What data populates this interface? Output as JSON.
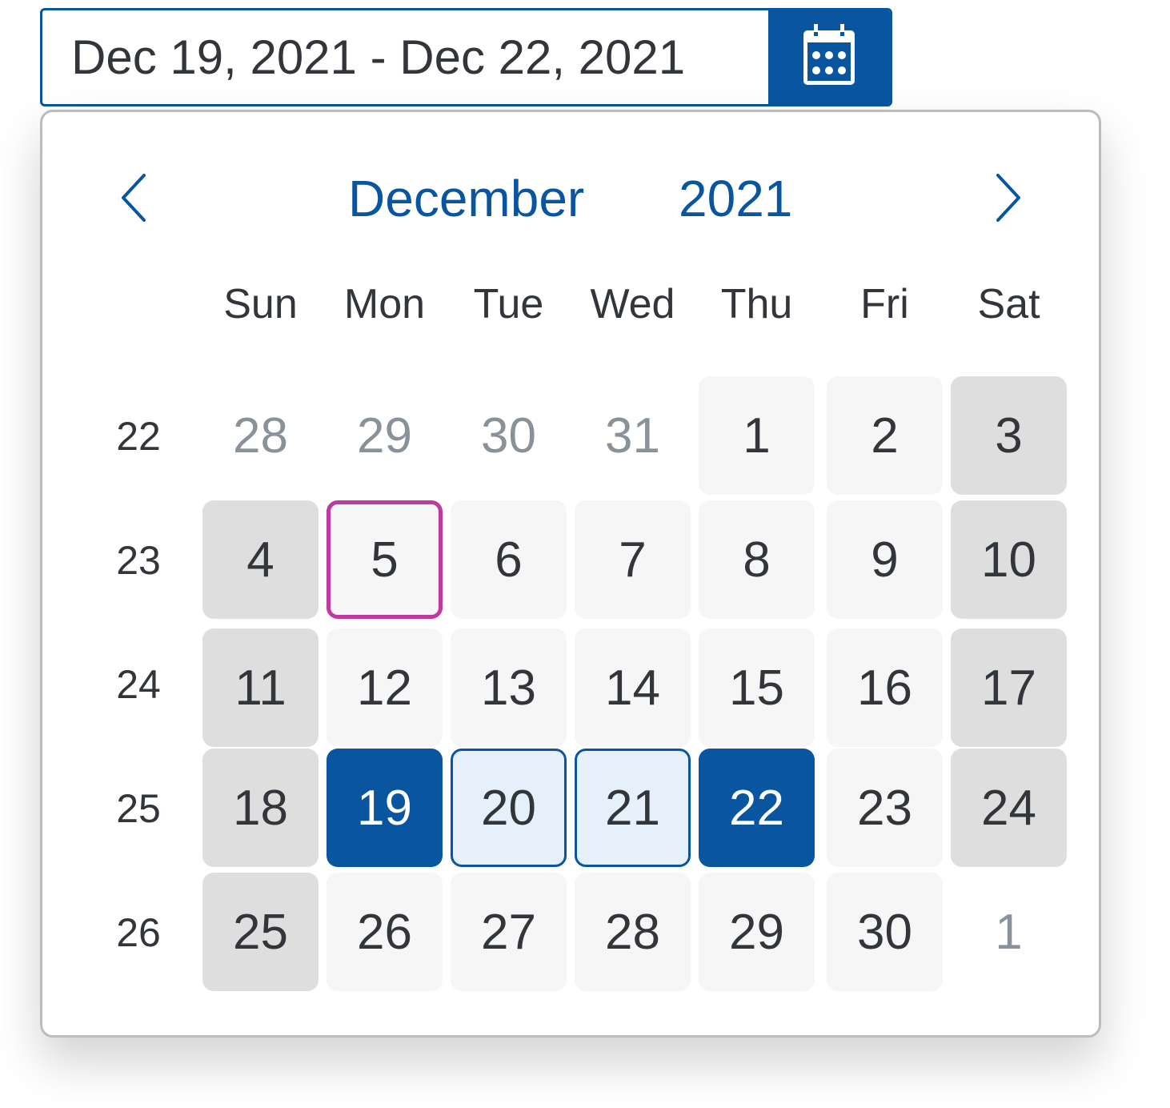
{
  "date_range_input": {
    "value": "Dec 19, 2021 - Dec 22, 2021",
    "button_icon": "calendar-icon"
  },
  "calendar": {
    "month_label": "December",
    "year_label": "2021",
    "prev_icon": "chevron-left-icon",
    "next_icon": "chevron-right-icon",
    "weekdays": [
      "Sun",
      "Mon",
      "Tue",
      "Wed",
      "Thu",
      "Fri",
      "Sat"
    ],
    "weeks": [
      {
        "number": "22",
        "days": [
          {
            "label": "28",
            "state": "other"
          },
          {
            "label": "29",
            "state": "other"
          },
          {
            "label": "30",
            "state": "other"
          },
          {
            "label": "31",
            "state": "other"
          },
          {
            "label": "1",
            "state": "normal"
          },
          {
            "label": "2",
            "state": "normal"
          },
          {
            "label": "3",
            "state": "weekend"
          }
        ]
      },
      {
        "number": "23",
        "days": [
          {
            "label": "4",
            "state": "weekend"
          },
          {
            "label": "5",
            "state": "today"
          },
          {
            "label": "6",
            "state": "normal"
          },
          {
            "label": "7",
            "state": "normal"
          },
          {
            "label": "8",
            "state": "normal"
          },
          {
            "label": "9",
            "state": "normal"
          },
          {
            "label": "10",
            "state": "weekend"
          }
        ]
      },
      {
        "number": "24",
        "days": [
          {
            "label": "11",
            "state": "weekend"
          },
          {
            "label": "12",
            "state": "normal"
          },
          {
            "label": "13",
            "state": "normal"
          },
          {
            "label": "14",
            "state": "normal"
          },
          {
            "label": "15",
            "state": "normal"
          },
          {
            "label": "16",
            "state": "normal"
          },
          {
            "label": "17",
            "state": "weekend"
          }
        ]
      },
      {
        "number": "25",
        "days": [
          {
            "label": "18",
            "state": "weekend"
          },
          {
            "label": "19",
            "state": "selected-start"
          },
          {
            "label": "20",
            "state": "in-range"
          },
          {
            "label": "21",
            "state": "in-range"
          },
          {
            "label": "22",
            "state": "selected-end"
          },
          {
            "label": "23",
            "state": "normal"
          },
          {
            "label": "24",
            "state": "weekend"
          }
        ]
      },
      {
        "number": "26",
        "days": [
          {
            "label": "25",
            "state": "weekend"
          },
          {
            "label": "26",
            "state": "normal"
          },
          {
            "label": "27",
            "state": "normal"
          },
          {
            "label": "28",
            "state": "normal"
          },
          {
            "label": "29",
            "state": "normal"
          },
          {
            "label": "30",
            "state": "normal"
          },
          {
            "label": "1",
            "state": "other"
          }
        ]
      }
    ]
  },
  "colors": {
    "accent": "#0a55a0",
    "today_border": "#c0399f",
    "range_fill": "#e5f0fa",
    "weekend_fill": "#dedede",
    "weekday_fill": "#f6f6f6",
    "other_month_text": "#89919a",
    "text": "#32363a"
  }
}
